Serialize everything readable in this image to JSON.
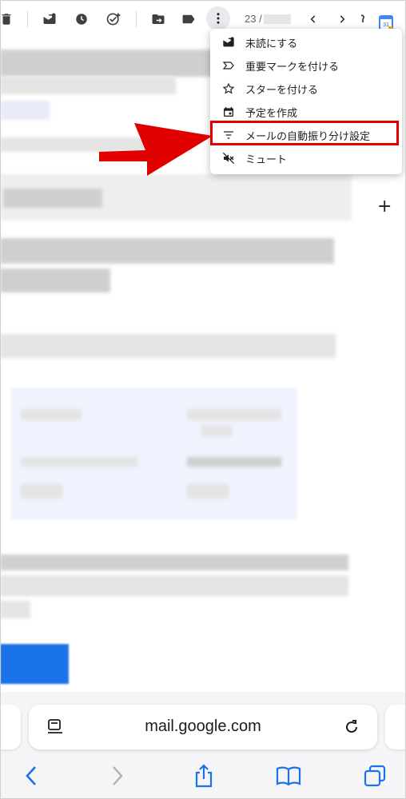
{
  "toolbar": {
    "count_prefix": "23 /",
    "icons": [
      "delete-icon",
      "mark-unread-icon",
      "snooze-icon",
      "add-task-icon",
      "move-to-icon",
      "label-icon",
      "more-vert-icon",
      "chevron-left-icon",
      "chevron-right-icon",
      "calendar-icon"
    ]
  },
  "menu": {
    "items": [
      {
        "label": "未読にする",
        "icon": "mark-unread-icon"
      },
      {
        "label": "重要マークを付ける",
        "icon": "important-icon"
      },
      {
        "label": "スターを付ける",
        "icon": "star-icon"
      },
      {
        "label": "予定を作成",
        "icon": "calendar-event-icon"
      },
      {
        "label": "メールの自動振り分け設定",
        "icon": "filter-icon"
      },
      {
        "label": "ミュート",
        "icon": "mute-icon"
      }
    ],
    "highlighted_index": 4
  },
  "content": {
    "add_symbol": "+"
  },
  "browser": {
    "url": "mail.google.com"
  },
  "colors": {
    "highlight": "#e00000",
    "accent_blue": "#1a73e8"
  }
}
